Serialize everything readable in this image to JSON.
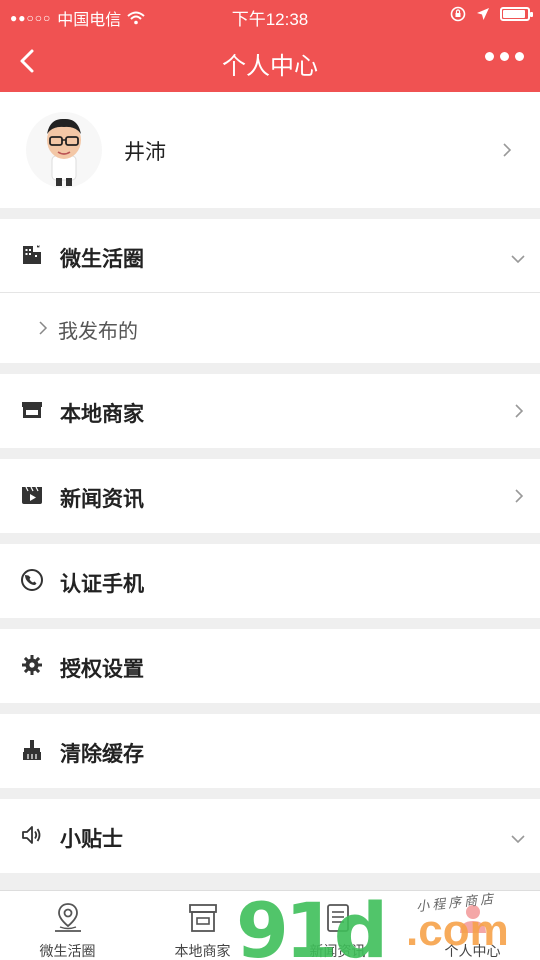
{
  "status_bar": {
    "signal": "●●○○○",
    "carrier": "中国电信",
    "time": "下午12:38",
    "battery_level": 0.9
  },
  "nav": {
    "title": "个人中心"
  },
  "profile": {
    "name": "井沛"
  },
  "sections": {
    "circle": {
      "label": "微生活圈",
      "sub_item": "我发布的"
    },
    "merchants": {
      "label": "本地商家"
    },
    "news": {
      "label": "新闻资讯"
    },
    "verify_phone": {
      "label": "认证手机"
    },
    "authorize": {
      "label": "授权设置"
    },
    "clear_cache": {
      "label": "清除缓存"
    },
    "tips": {
      "label": "小贴士"
    }
  },
  "tabbar": {
    "tabs": [
      {
        "label": "微生活圈",
        "icon": "location-pin-icon"
      },
      {
        "label": "本地商家",
        "icon": "store-icon"
      },
      {
        "label": "新闻资讯",
        "icon": "news-icon"
      },
      {
        "label": "个人中心",
        "icon": "user-icon"
      }
    ]
  },
  "watermark": {
    "brand": "91",
    "brand2": "d",
    "tld": ".com",
    "tagline": "小程序商店"
  },
  "colors": {
    "accent": "#f05252",
    "background": "#efefef",
    "watermark_green": "#3fbf5a",
    "watermark_orange": "#f7a24a"
  }
}
